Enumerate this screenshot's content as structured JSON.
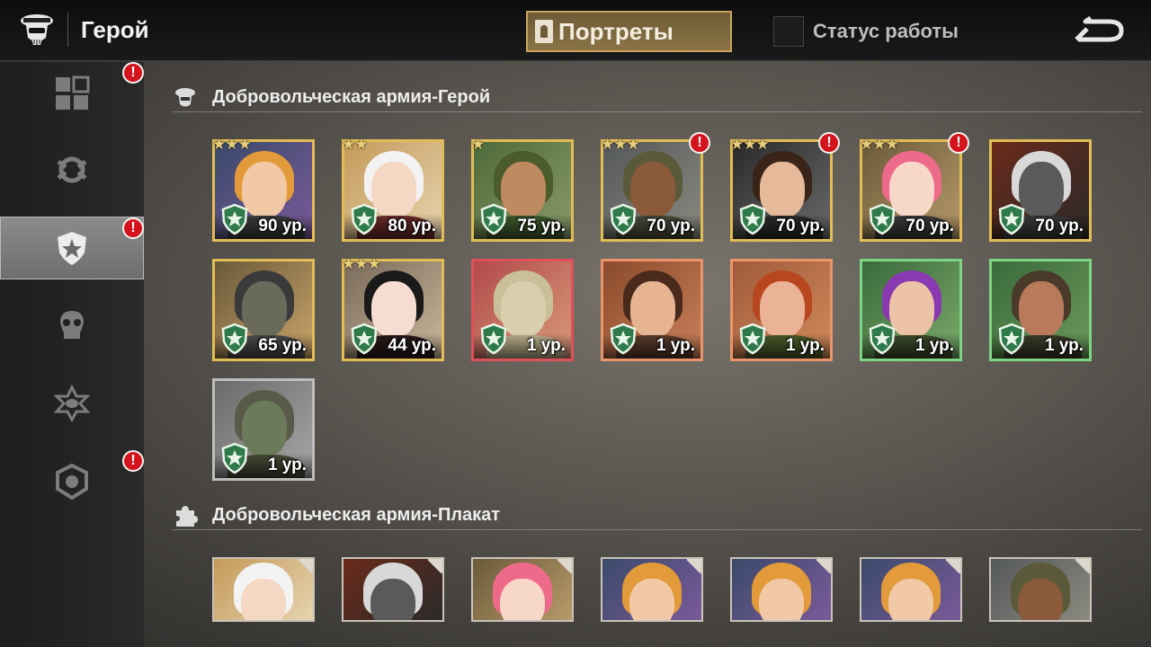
{
  "header": {
    "title": "Герой",
    "tab_portraits": "Портреты",
    "work_status_label": "Статус работы"
  },
  "sidebar": {
    "items": [
      {
        "name": "grid",
        "badge": "!"
      },
      {
        "name": "gear-wrench",
        "badge": ""
      },
      {
        "name": "shield-star",
        "badge": "!",
        "active": true
      },
      {
        "name": "skull",
        "badge": ""
      },
      {
        "name": "star-eye",
        "badge": ""
      },
      {
        "name": "helmet",
        "badge": "!"
      }
    ]
  },
  "sections": {
    "heroes_title": "Добровольческая армия-Герой",
    "posters_title": "Добровольческая армия-Плакат"
  },
  "heroes": [
    {
      "level": "90 ур.",
      "stars": "★★★",
      "rarity": "gold",
      "alert": ""
    },
    {
      "level": "80 ур.",
      "stars": "★★",
      "rarity": "gold",
      "alert": ""
    },
    {
      "level": "75 ур.",
      "stars": "★",
      "rarity": "gold",
      "alert": ""
    },
    {
      "level": "70 ур.",
      "stars": "★★★",
      "rarity": "gold",
      "alert": "!"
    },
    {
      "level": "70 ур.",
      "stars": "★★★",
      "rarity": "gold",
      "alert": "!"
    },
    {
      "level": "70 ур.",
      "stars": "★★★",
      "rarity": "gold",
      "alert": "!"
    },
    {
      "level": "70 ур.",
      "stars": "",
      "rarity": "gold",
      "alert": ""
    },
    {
      "level": "65 ур.",
      "stars": "",
      "rarity": "gold",
      "alert": ""
    },
    {
      "level": "44 ур.",
      "stars": "★★★",
      "rarity": "gold",
      "alert": ""
    },
    {
      "level": "1 ур.",
      "stars": "",
      "rarity": "red",
      "alert": ""
    },
    {
      "level": "1 ур.",
      "stars": "",
      "rarity": "orange",
      "alert": ""
    },
    {
      "level": "1 ур.",
      "stars": "",
      "rarity": "orange",
      "alert": ""
    },
    {
      "level": "1 ур.",
      "stars": "",
      "rarity": "green",
      "alert": ""
    },
    {
      "level": "1 ур.",
      "stars": "",
      "rarity": "green",
      "alert": ""
    },
    {
      "level": "1 ур.",
      "stars": "",
      "rarity": "gray",
      "alert": ""
    }
  ],
  "colors": {
    "accent_gold": "#e2bc55",
    "alert_red": "#d4141c",
    "rarity_green": "#7fd483",
    "rarity_red": "#e0505a",
    "rarity_orange": "#e9946a"
  }
}
